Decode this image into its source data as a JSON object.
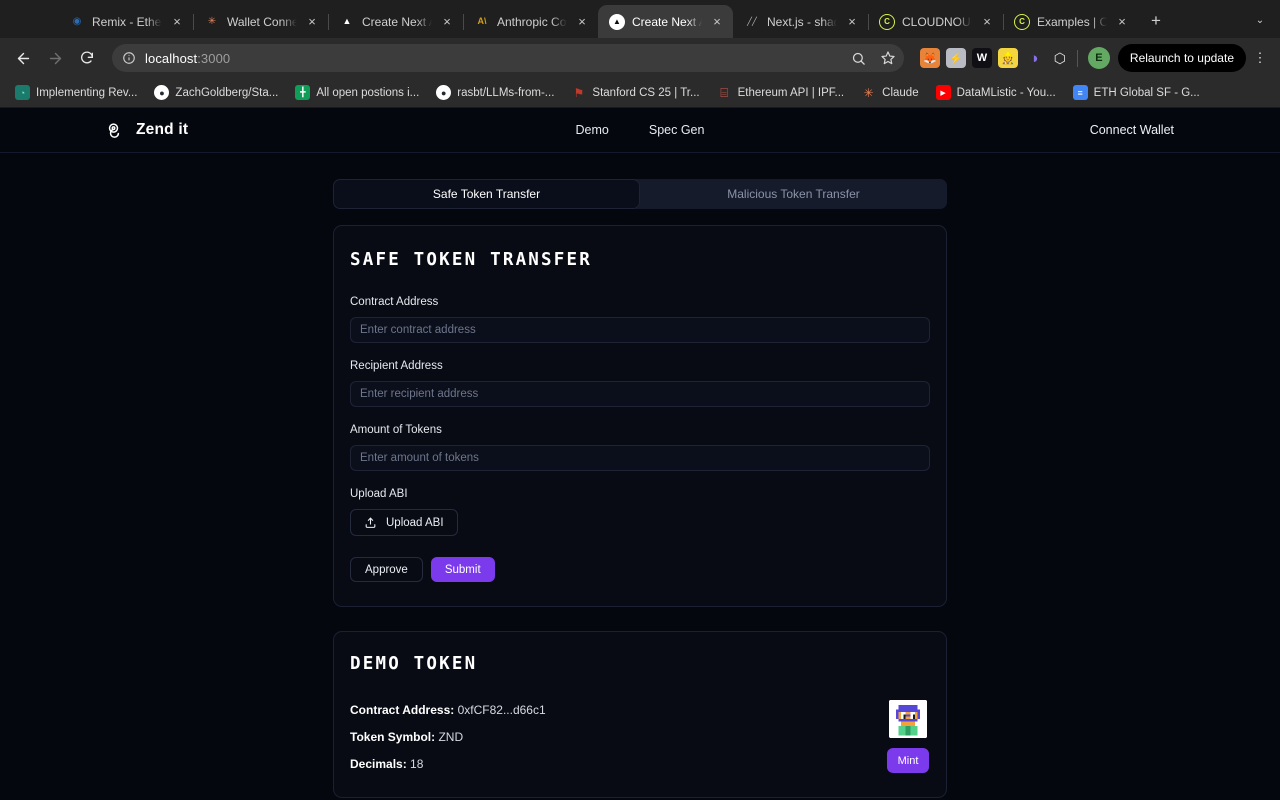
{
  "browser": {
    "tabs": [
      {
        "title": "Remix - Ethere",
        "icon": "remix-icon",
        "glyph": "◉",
        "color": "#2b6cb0",
        "bg": "transparent",
        "active": false
      },
      {
        "title": "Wallet Connec",
        "icon": "walletconnect-icon",
        "glyph": "✳",
        "color": "#e8845c",
        "bg": "transparent",
        "active": false
      },
      {
        "title": "Create Next Ap",
        "icon": "nextjs-icon",
        "glyph": "▲",
        "color": "#ffffff",
        "bg": "transparent",
        "active": false
      },
      {
        "title": "Anthropic Con",
        "icon": "anthropic-icon",
        "glyph": "A\\",
        "color": "#d4a017",
        "bg": "transparent",
        "active": false
      },
      {
        "title": "Create Next Ap",
        "icon": "nextjs-icon",
        "glyph": "▲",
        "color": "#0c0c0c",
        "bg": "#ffffff",
        "active": true
      },
      {
        "title": "Next.js - shadc",
        "icon": "shadcn-icon",
        "glyph": "╱╱",
        "color": "#b8b8b8",
        "bg": "transparent",
        "active": false
      },
      {
        "title": "CLOUDNOUNS",
        "icon": "cloudnouns-icon",
        "glyph": "C",
        "color": "#d8f24a",
        "bg": "transparent",
        "active": false
      },
      {
        "title": "Examples | CLO",
        "icon": "cloudnouns-icon",
        "glyph": "C",
        "color": "#d8f24a",
        "bg": "transparent",
        "active": false
      }
    ],
    "new_tab_label": "+",
    "tab_list_chevron": "⌄",
    "close_label": "×",
    "nav": {
      "back": "←",
      "forward": "→",
      "reload": "↻"
    },
    "omnibox": {
      "info_icon": "ⓘ",
      "host": "localhost",
      "port": ":3000",
      "zoom_icon": "⌕",
      "bookmark_icon": "☆"
    },
    "extensions": [
      {
        "name": "metamask-extension",
        "glyph": "🦊",
        "bg": "#e8833a",
        "color": "#ffffff"
      },
      {
        "name": "flashbots-extension",
        "glyph": "⚡",
        "bg": "#b9bcc4",
        "color": "#3a3d45"
      },
      {
        "name": "wombat-extension",
        "glyph": "W",
        "bg": "#0f0f14",
        "color": "#ffffff"
      },
      {
        "name": "pocket-universe-extension",
        "glyph": "👷",
        "bg": "#f3d53f",
        "color": "#7a2d06"
      },
      {
        "name": "rabby-extension",
        "glyph": "◑",
        "bg": "#8b6ef0",
        "color": "#ffffff"
      },
      {
        "name": "extensions-puzzle",
        "glyph": "⬡",
        "bg": "transparent",
        "color": "#e6e6e6"
      }
    ],
    "profile_initial": "E",
    "relaunch_label": "Relaunch to update",
    "kebab_label": "⋮",
    "bookmarks": [
      {
        "title": "Implementing Rev...",
        "icon": "medium-icon",
        "glyph": "◔",
        "bg": "#1a7a6b",
        "color": "#7be3c8"
      },
      {
        "title": "ZachGoldberg/Sta...",
        "icon": "github-icon",
        "glyph": "●",
        "bg": "#ffffff",
        "color": "#24292e"
      },
      {
        "title": "All open postions i...",
        "icon": "sheets-icon",
        "glyph": "╋",
        "bg": "#0f9d58",
        "color": "#ffffff"
      },
      {
        "title": "rasbt/LLMs-from-...",
        "icon": "github-icon",
        "glyph": "●",
        "bg": "#ffffff",
        "color": "#24292e"
      },
      {
        "title": "Stanford CS 25 | Tr...",
        "icon": "stanford-icon",
        "glyph": "⚑",
        "bg": "transparent",
        "color": "#c0392b"
      },
      {
        "title": "Ethereum API | IPF...",
        "icon": "infura-icon",
        "glyph": "⌸",
        "bg": "transparent",
        "color": "#e05a4f"
      },
      {
        "title": "Claude",
        "icon": "claude-icon",
        "glyph": "✳",
        "bg": "transparent",
        "color": "#e8845c"
      },
      {
        "title": "DataMListic - You...",
        "icon": "youtube-icon",
        "glyph": "▶",
        "bg": "#ff0000",
        "color": "#ffffff"
      },
      {
        "title": "ETH Global SF - G...",
        "icon": "docs-icon",
        "glyph": "≡",
        "bg": "#4285f4",
        "color": "#ffffff"
      }
    ]
  },
  "site": {
    "brand": "Zend it",
    "brand_icon": "coins-icon",
    "nav": [
      {
        "label": "Demo",
        "name": "nav-demo"
      },
      {
        "label": "Spec Gen",
        "name": "nav-spec-gen"
      }
    ],
    "connect_wallet": "Connect Wallet"
  },
  "tabs": {
    "safe": "Safe Token Transfer",
    "malicious": "Malicious Token Transfer",
    "active": "safe"
  },
  "form": {
    "title": "SAFE TOKEN TRANSFER",
    "fields": [
      {
        "label": "Contract Address",
        "placeholder": "Enter contract address",
        "value": "",
        "name": "contract-address"
      },
      {
        "label": "Recipient Address",
        "placeholder": "Enter recipient address",
        "value": "",
        "name": "recipient-address"
      },
      {
        "label": "Amount of Tokens",
        "placeholder": "Enter amount of tokens",
        "value": "",
        "name": "amount-of-tokens"
      }
    ],
    "upload_label": "Upload ABI",
    "upload_button": "Upload ABI",
    "upload_icon": "upload-icon",
    "approve_label": "Approve",
    "submit_label": "Submit"
  },
  "token": {
    "title": "DEMO TOKEN",
    "rows": [
      {
        "label": "Contract Address:",
        "value": "0xfCF82...d66c1",
        "name": "contract-address"
      },
      {
        "label": "Token Symbol:",
        "value": "ZND",
        "name": "token-symbol"
      },
      {
        "label": "Decimals:",
        "value": "18",
        "name": "decimals"
      }
    ],
    "mint_label": "Mint",
    "avatar_icon": "nouns-avatar"
  },
  "colors": {
    "accent": "#7c3aed",
    "page_bg": "#05070f",
    "card_bg": "#080b14",
    "card_border": "#1b2133",
    "muted_text": "#6e768c"
  }
}
